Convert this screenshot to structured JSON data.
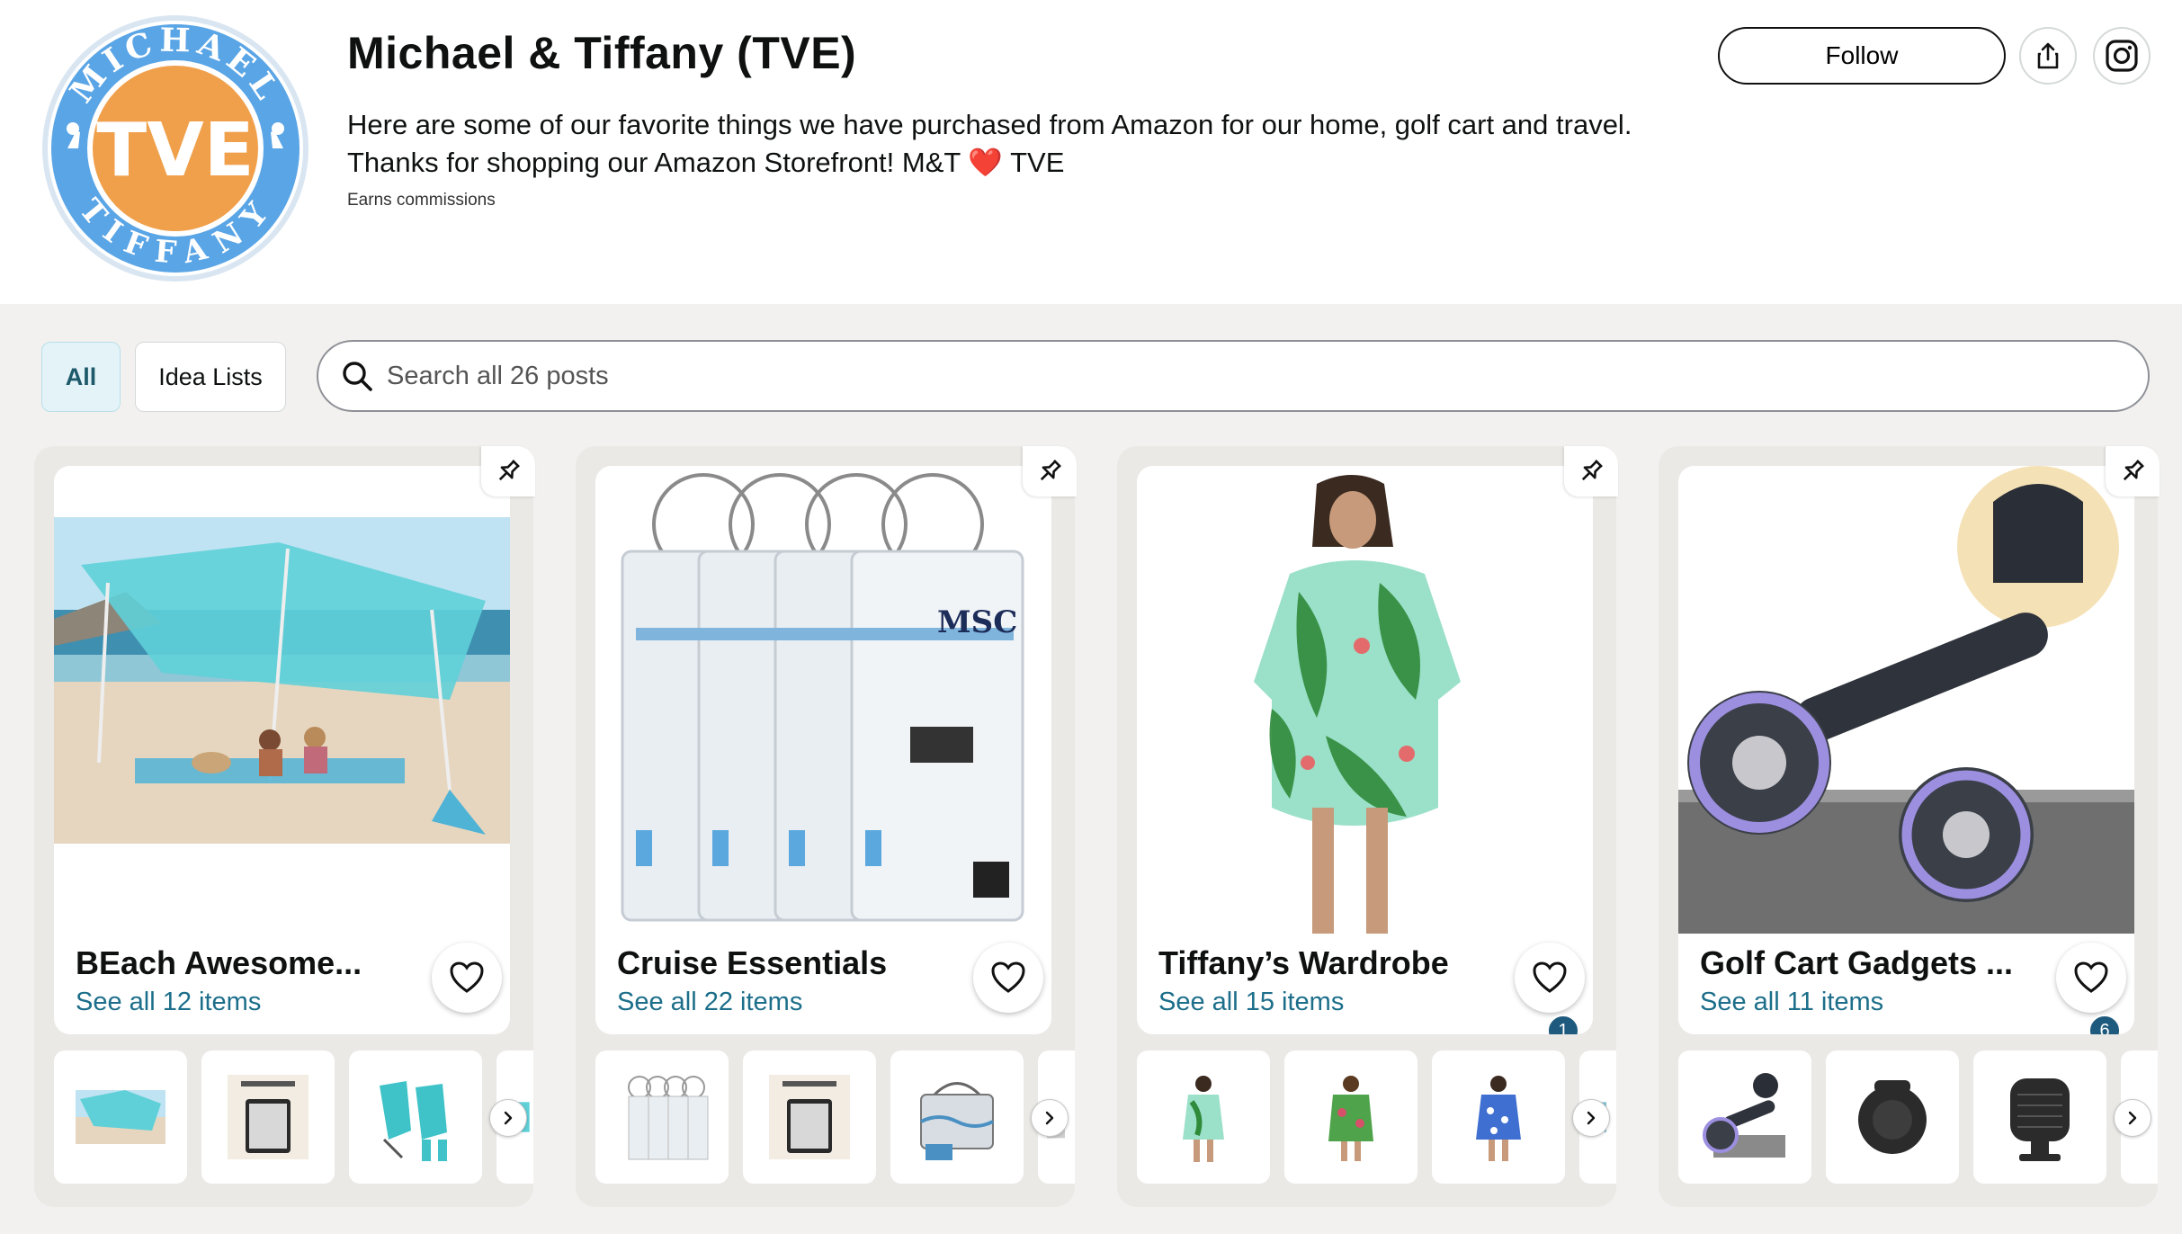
{
  "profile": {
    "logo": {
      "alt": "Michael & Tiffany TVE logo",
      "top_text": "MICHAEL",
      "center_text": "TVE",
      "bottom_text": "TIFFANY"
    },
    "title": "Michael & Tiffany (TVE)",
    "description_line1": "Here are some of our favorite things we have purchased from Amazon for our home, golf cart and travel.",
    "description_line2_pre": "Thanks for shopping our Amazon Storefront! M&T",
    "description_heart": "❤️",
    "description_line2_post": "TVE",
    "earns": "Earns commissions",
    "follow_label": "Follow"
  },
  "filters": {
    "all": "All",
    "idea_lists": "Idea Lists"
  },
  "search": {
    "placeholder": "Search all 26 posts",
    "value": ""
  },
  "cards": [
    {
      "title": "BEach Awesome...",
      "link": "See all 12 items",
      "likes": ""
    },
    {
      "title": "Cruise Essentials",
      "link": "See all 22 items",
      "likes": ""
    },
    {
      "title": "Tiffany’s Wardrobe",
      "link": "See all 15 items",
      "likes": "1"
    },
    {
      "title": "Golf Cart Gadgets ...",
      "link": "See all 11 items",
      "likes": "6"
    }
  ],
  "icons": {
    "search": "search-icon",
    "share": "share-icon",
    "instagram": "instagram-icon",
    "heart": "heart-icon",
    "pin": "pin-icon",
    "next": "chevron-right-icon"
  },
  "colors": {
    "logo_blue": "#5aa5e6",
    "logo_orange": "#f0a04b",
    "link": "#1c6e8a",
    "badge": "#1e5a7d"
  }
}
